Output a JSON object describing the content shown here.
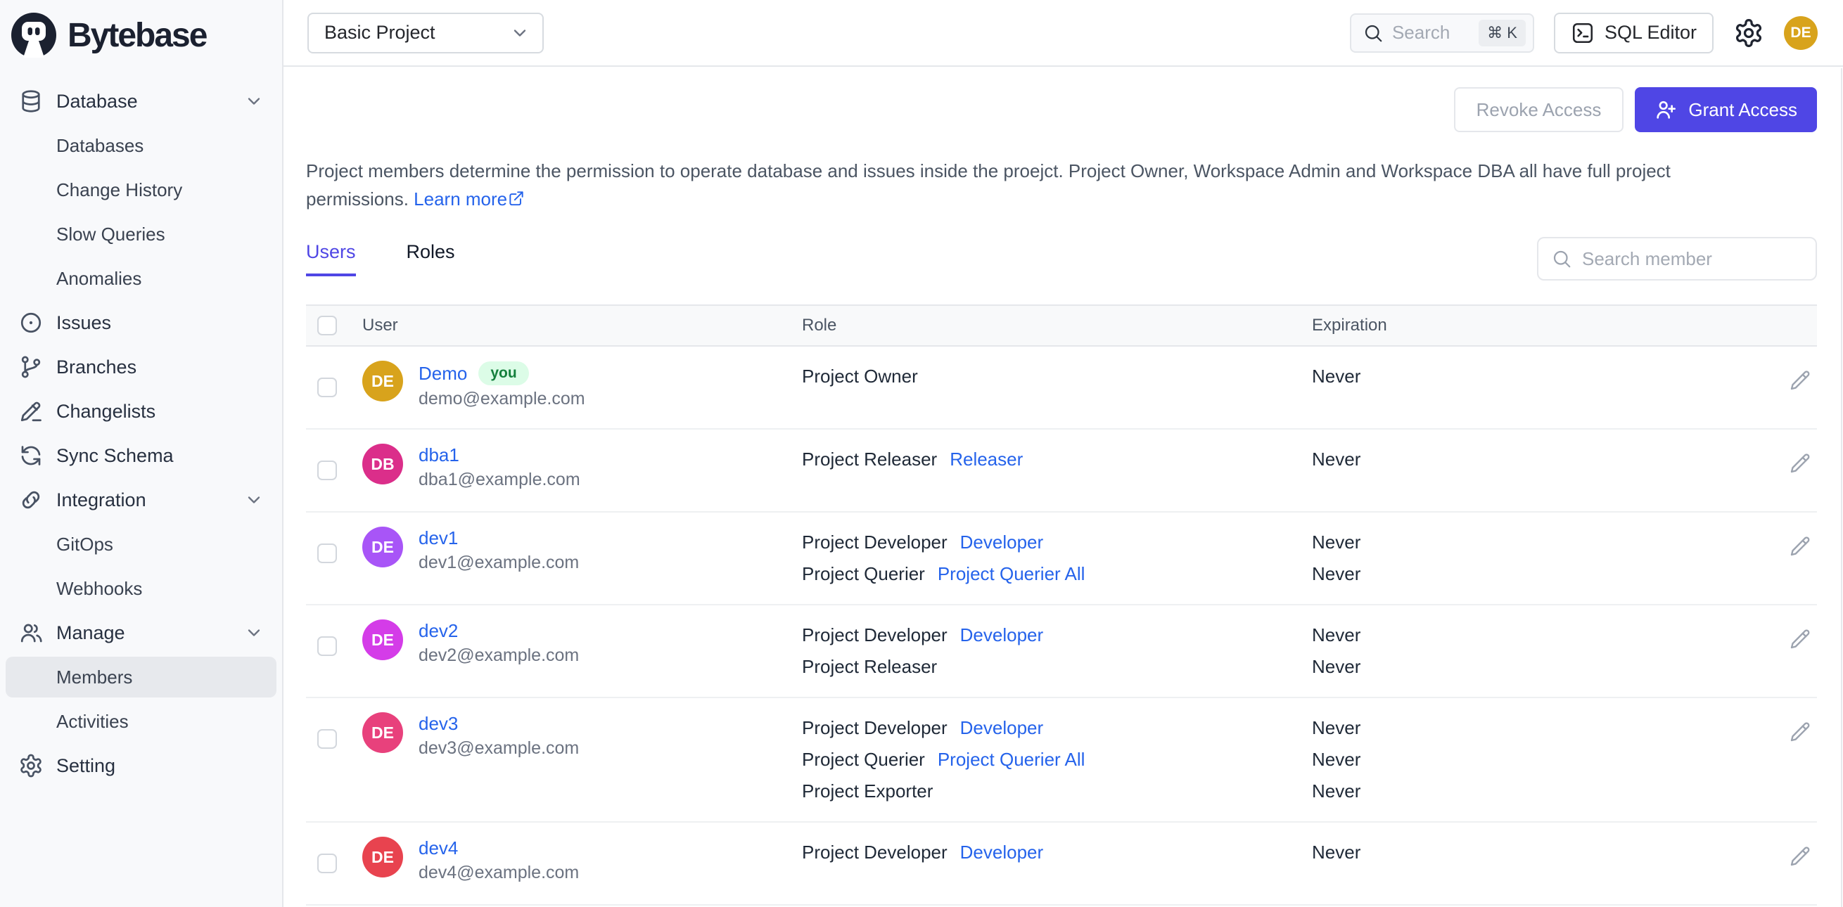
{
  "topbar": {
    "logo_text": "Bytebase",
    "project_selector_value": "Basic Project",
    "search_placeholder": "Search",
    "search_shortcut": "⌘ K",
    "sql_editor_label": "SQL Editor",
    "user_initials": "DE"
  },
  "sidebar": {
    "items": [
      {
        "label": "Database",
        "icon": "database",
        "chevron": true,
        "level": 0
      },
      {
        "label": "Databases",
        "level": 1
      },
      {
        "label": "Change History",
        "level": 1
      },
      {
        "label": "Slow Queries",
        "level": 1
      },
      {
        "label": "Anomalies",
        "level": 1
      },
      {
        "label": "Issues",
        "icon": "issues",
        "level": 0
      },
      {
        "label": "Branches",
        "icon": "branch",
        "level": 0
      },
      {
        "label": "Changelists",
        "icon": "changelist",
        "level": 0
      },
      {
        "label": "Sync Schema",
        "icon": "sync",
        "level": 0
      },
      {
        "label": "Integration",
        "icon": "integration",
        "chevron": true,
        "level": 0
      },
      {
        "label": "GitOps",
        "level": 1
      },
      {
        "label": "Webhooks",
        "level": 1
      },
      {
        "label": "Manage",
        "icon": "manage",
        "chevron": true,
        "level": 0
      },
      {
        "label": "Members",
        "level": 1,
        "active": true
      },
      {
        "label": "Activities",
        "level": 1
      },
      {
        "label": "Setting",
        "icon": "gear",
        "level": 0
      }
    ]
  },
  "actions": {
    "revoke_label": "Revoke Access",
    "grant_label": "Grant Access"
  },
  "description": {
    "text": "Project members determine the permission to operate database and issues inside the proejct. Project Owner, Workspace Admin and Workspace DBA all have full project permissions.",
    "link_label": "Learn more"
  },
  "tabs": {
    "users": "Users",
    "roles": "Roles"
  },
  "member_search_placeholder": "Search member",
  "members_table": {
    "columns": {
      "user": "User",
      "role": "Role",
      "expiration": "Expiration"
    },
    "rows": [
      {
        "initials": "DE",
        "avatar_color": "#D8A31C",
        "name": "Demo",
        "you_badge": "you",
        "email": "demo@example.com",
        "roles": [
          {
            "role": "Project Owner",
            "link": ""
          }
        ],
        "expirations": [
          "Never"
        ]
      },
      {
        "initials": "DB",
        "avatar_color": "#DB2E8A",
        "name": "dba1",
        "email": "dba1@example.com",
        "roles": [
          {
            "role": "Project Releaser",
            "link": "Releaser"
          }
        ],
        "expirations": [
          "Never"
        ]
      },
      {
        "initials": "DE",
        "avatar_color": "#A855F7",
        "name": "dev1",
        "email": "dev1@example.com",
        "roles": [
          {
            "role": "Project Developer",
            "link": "Developer"
          },
          {
            "role": "Project Querier",
            "link": "Project Querier All"
          }
        ],
        "expirations": [
          "Never",
          "Never"
        ]
      },
      {
        "initials": "DE",
        "avatar_color": "#D43CE8",
        "name": "dev2",
        "email": "dev2@example.com",
        "roles": [
          {
            "role": "Project Developer",
            "link": "Developer"
          },
          {
            "role": "Project Releaser",
            "link": ""
          }
        ],
        "expirations": [
          "Never",
          "Never"
        ]
      },
      {
        "initials": "DE",
        "avatar_color": "#E8417C",
        "name": "dev3",
        "email": "dev3@example.com",
        "roles": [
          {
            "role": "Project Developer",
            "link": "Developer"
          },
          {
            "role": "Project Querier",
            "link": "Project Querier All"
          },
          {
            "role": "Project Exporter",
            "link": ""
          }
        ],
        "expirations": [
          "Never",
          "Never",
          "Never"
        ]
      },
      {
        "initials": "DE",
        "avatar_color": "#E8434F",
        "name": "dev4",
        "email": "dev4@example.com",
        "roles": [
          {
            "role": "Project Developer",
            "link": "Developer"
          }
        ],
        "expirations": [
          "Never"
        ]
      }
    ]
  },
  "colors": {
    "accent": "#4F46E5",
    "link": "#2563EB",
    "brand": "#1B2130",
    "avatar_gold": "#D8A31C",
    "badge_bg": "#DCFCE7",
    "badge_text": "#15803D",
    "sidebar_bg": "#F8F9FB",
    "active_item_bg": "#E7E9ED"
  }
}
